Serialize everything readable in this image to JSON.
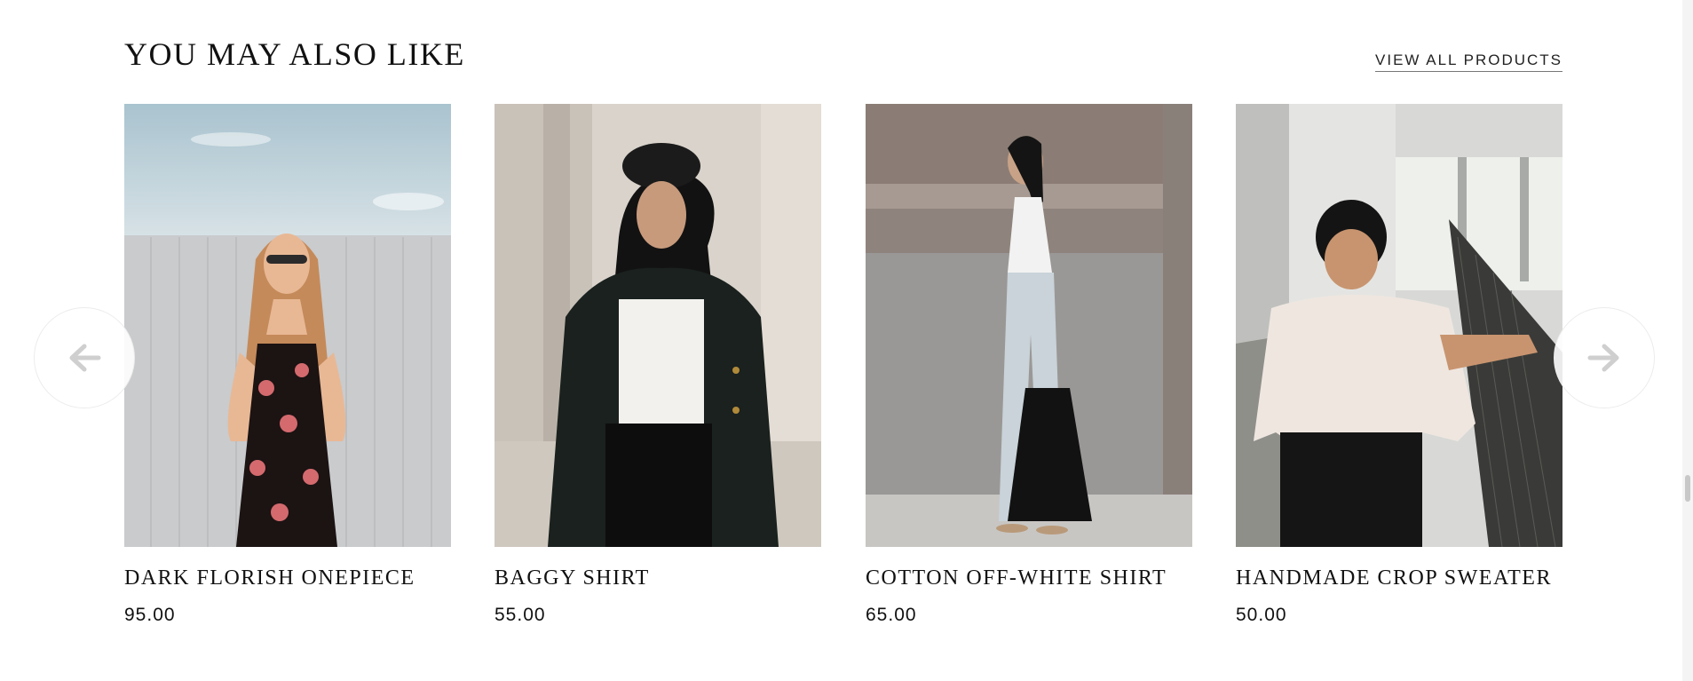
{
  "section": {
    "title": "YOU MAY ALSO LIKE",
    "view_all_label": "VIEW ALL PRODUCTS"
  },
  "products": [
    {
      "name": "DARK FLORISH ONEPIECE",
      "price": "95.00"
    },
    {
      "name": "BAGGY SHIRT",
      "price": "55.00"
    },
    {
      "name": "COTTON OFF-WHITE SHIRT",
      "price": "65.00"
    },
    {
      "name": "HANDMADE CROP SWEATER",
      "price": "50.00"
    }
  ],
  "icons": {
    "prev": "arrow-left-icon",
    "next": "arrow-right-icon"
  },
  "colors": {
    "text": "#111111",
    "arrow": "#cfcfcf",
    "background": "#ffffff"
  }
}
